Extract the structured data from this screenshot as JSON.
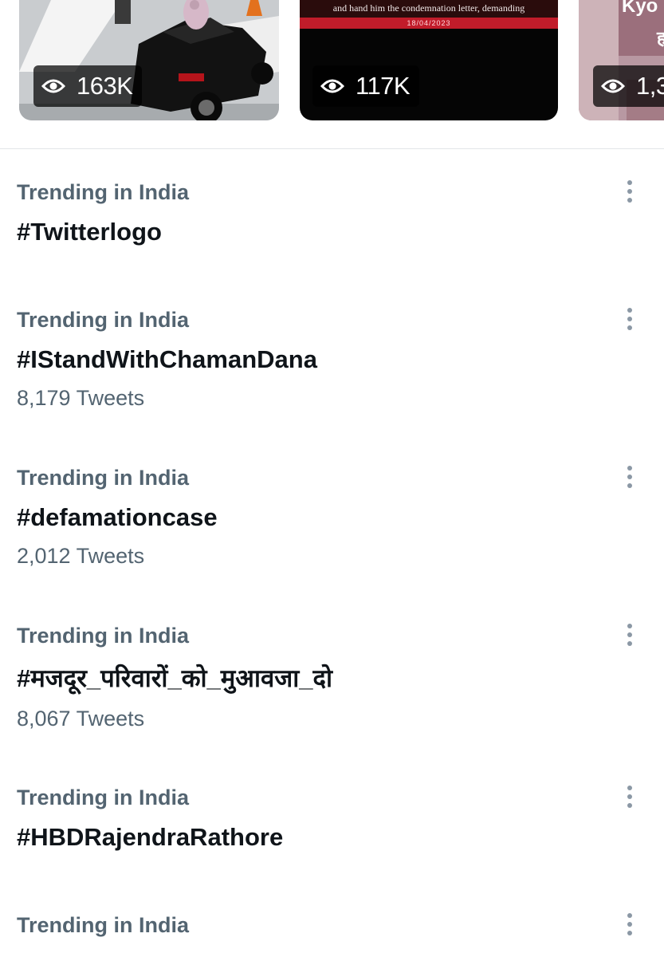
{
  "media": [
    {
      "views": "163K",
      "icon": "eye-icon"
    },
    {
      "views": "117K",
      "icon": "eye-icon",
      "caption": "and hand him the condemnation letter, demanding",
      "caption_date": "18/04/2023"
    },
    {
      "views": "1,3",
      "icon": "eye-icon",
      "overlay_text": "Kyo",
      "overlay_text2": "ह"
    }
  ],
  "trends": [
    {
      "context": "Trending in India",
      "name": "#Twitterlogo",
      "count": ""
    },
    {
      "context": "Trending in India",
      "name": "#IStandWithChamanDana",
      "count": "8,179 Tweets"
    },
    {
      "context": "Trending in India",
      "name": "#defamationcase",
      "count": "2,012 Tweets"
    },
    {
      "context": "Trending in India",
      "name": "#मजदूर_परिवारों_को_मुआवजा_दो",
      "count": "8,067 Tweets"
    },
    {
      "context": "Trending in India",
      "name": "#HBDRajendraRathore",
      "count": ""
    },
    {
      "context": "Trending in India",
      "name": "",
      "count": ""
    }
  ],
  "colors": {
    "primary_text": "#0f1419",
    "secondary_text": "#536471",
    "divider": "#e3e6e8",
    "more_icon": "#8b98a5"
  }
}
